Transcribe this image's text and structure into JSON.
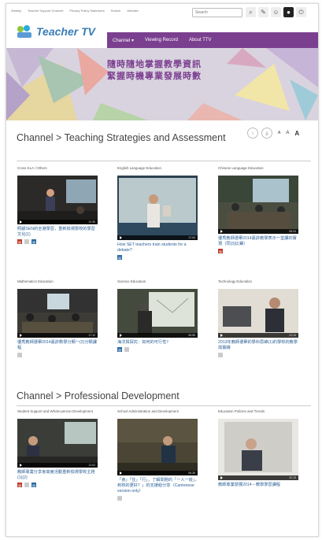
{
  "topbar": {
    "links": [
      "Weekly",
      "Teacher Support Channel",
      "Privacy Policy Statement",
      "Search",
      "Website"
    ],
    "search_placeholder": "Search"
  },
  "logo": {
    "text": "Teacher TV"
  },
  "nav": {
    "items": [
      "Channel ▾",
      "Viewing Record",
      "About TTV"
    ]
  },
  "banner": {
    "line1": "隨時隨地掌握教學資訊",
    "line2": "緊握時機專業發展時數"
  },
  "font_size_controls": [
    "A",
    "A",
    "A"
  ],
  "sections": [
    {
      "title": "Channel > Teaching Strategies and Assessment",
      "cards": [
        {
          "category": "Cross KLA / Others",
          "title": "照顧SEN的全港學習，重新檢視學校的學習文化(1)",
          "time": "12:35",
          "badges": [
            "r",
            "n",
            "blu"
          ]
        },
        {
          "category": "English Language Education",
          "title": "How SET teachers train students for a debate?",
          "time": "17:04",
          "badges": [
            "blu"
          ]
        },
        {
          "category": "Chinese Language Education",
          "title": "優秀教師選舉2014嘉許教學表示一堂課的實現（同(3)比賽）",
          "time": "08:34",
          "badges": [
            "r"
          ]
        },
        {
          "category": "Mathematics Education",
          "title": "優秀教師選舉2014嘉許數學分類一(2)分類課程",
          "time": "17:12",
          "badges": [
            "n"
          ]
        },
        {
          "category": "Science Education",
          "title": "海洋與探究：如何的可行性？",
          "time": "05:55",
          "badges": [
            "blu",
            "n"
          ]
        },
        {
          "category": "Technology Education",
          "title": "2013年教師選舉的學科思維(1)的學校的教學與實踐",
          "time": "23:15",
          "badges": [
            "n"
          ]
        }
      ]
    },
    {
      "title": "Channel > Professional Development",
      "cards": [
        {
          "category": "Student Support and Whole-person Development",
          "title": "教師專業分享會高度活動重新檢視學校主題(1)(2)",
          "time": "11:02",
          "badges": [
            "r",
            "n",
            "blu"
          ]
        },
        {
          "category": "School Administration and Development",
          "title": "「食」「住」「行」，了解問題的「一人一班」，到校的更好？」的支援組分享（Cantonese version only）",
          "time": "06:35",
          "badges": [
            "n"
          ]
        },
        {
          "category": "Education Policies and Trends",
          "title": "教師專業發展2014－教學學習課程",
          "time": "32:15",
          "badges": []
        }
      ]
    }
  ],
  "colors": {
    "nav": "#7b3f8f",
    "link": "#2a5f96",
    "logo": "#3a7db8"
  }
}
